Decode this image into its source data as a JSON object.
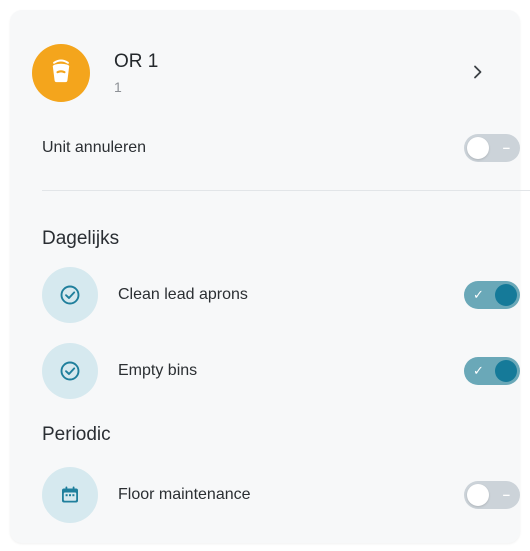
{
  "colors": {
    "card_background": "#f7f8f9",
    "avatar_orange": "#f4a51c",
    "task_icon_bg": "#d6e9ef",
    "task_icon_fg": "#1f7f9c",
    "toggle_on_track": "#6aa8b8",
    "toggle_on_knob": "#157a99",
    "toggle_off_track": "#ccd3d9"
  },
  "header": {
    "icon": "bucket-icon",
    "title": "OR 1",
    "subtitle": "1",
    "chevron_icon": "chevron-right-icon"
  },
  "cancel_unit": {
    "label": "Unit annuleren",
    "enabled": false
  },
  "sections": {
    "daily": {
      "title": "Dagelijks",
      "tasks": [
        {
          "label": "Clean lead aprons",
          "icon": "check-circle-icon",
          "enabled": true
        },
        {
          "label": "Empty bins",
          "icon": "check-circle-icon",
          "enabled": true
        }
      ]
    },
    "periodic": {
      "title": "Periodic",
      "tasks": [
        {
          "label": "Floor maintenance",
          "icon": "calendar-icon",
          "enabled": false
        }
      ]
    }
  }
}
